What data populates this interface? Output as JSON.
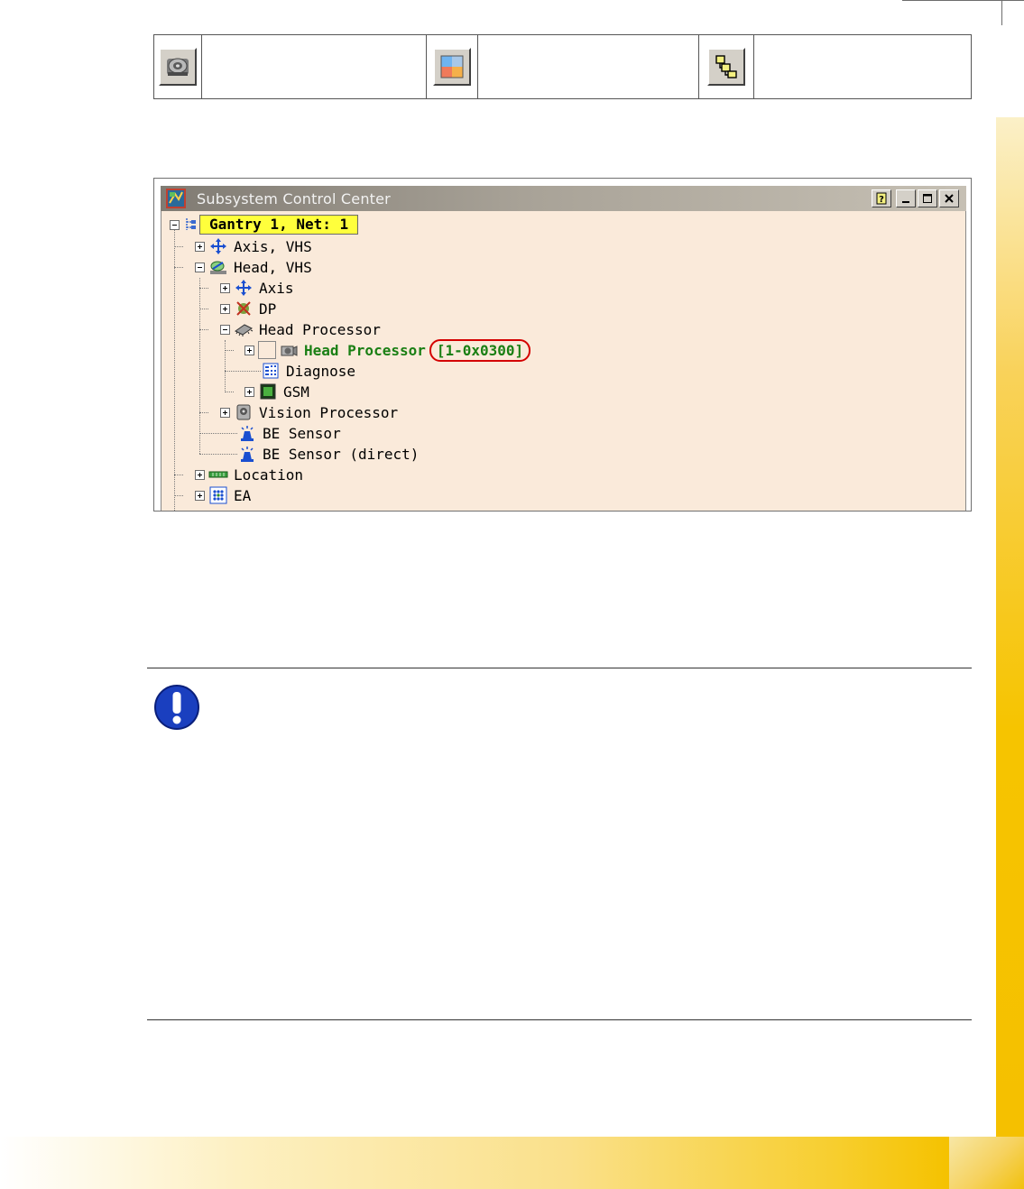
{
  "toolbar_table": {
    "icons": [
      "subsystem-control-center-icon",
      "color-layout-icon",
      "tree-hierarchy-icon"
    ]
  },
  "window": {
    "title": "Subsystem Control Center"
  },
  "tree": {
    "root": "Gantry 1, Net: 1",
    "items": {
      "axis_vhs": "Axis, VHS",
      "head_vhs": "Head, VHS",
      "axis": "Axis",
      "dp": "DP",
      "head_processor": "Head Processor",
      "head_processor_node": "Head Processor",
      "head_processor_address": "[1-0x0300]",
      "diagnose": "Diagnose",
      "gsm": "GSM",
      "vision_processor": "Vision Processor",
      "be_sensor": "BE Sensor",
      "be_sensor_direct": "BE Sensor (direct)",
      "location": "Location",
      "ea": "EA"
    }
  },
  "colors": {
    "tree_background": "#faeada",
    "root_highlight": "#ffff3c",
    "selected_text": "#1a7f14",
    "address_circle": "#d40000",
    "notice_icon": "#1a3fbf",
    "side_band": "#f5c000"
  },
  "notice": {
    "icon": "exclamation-icon"
  }
}
